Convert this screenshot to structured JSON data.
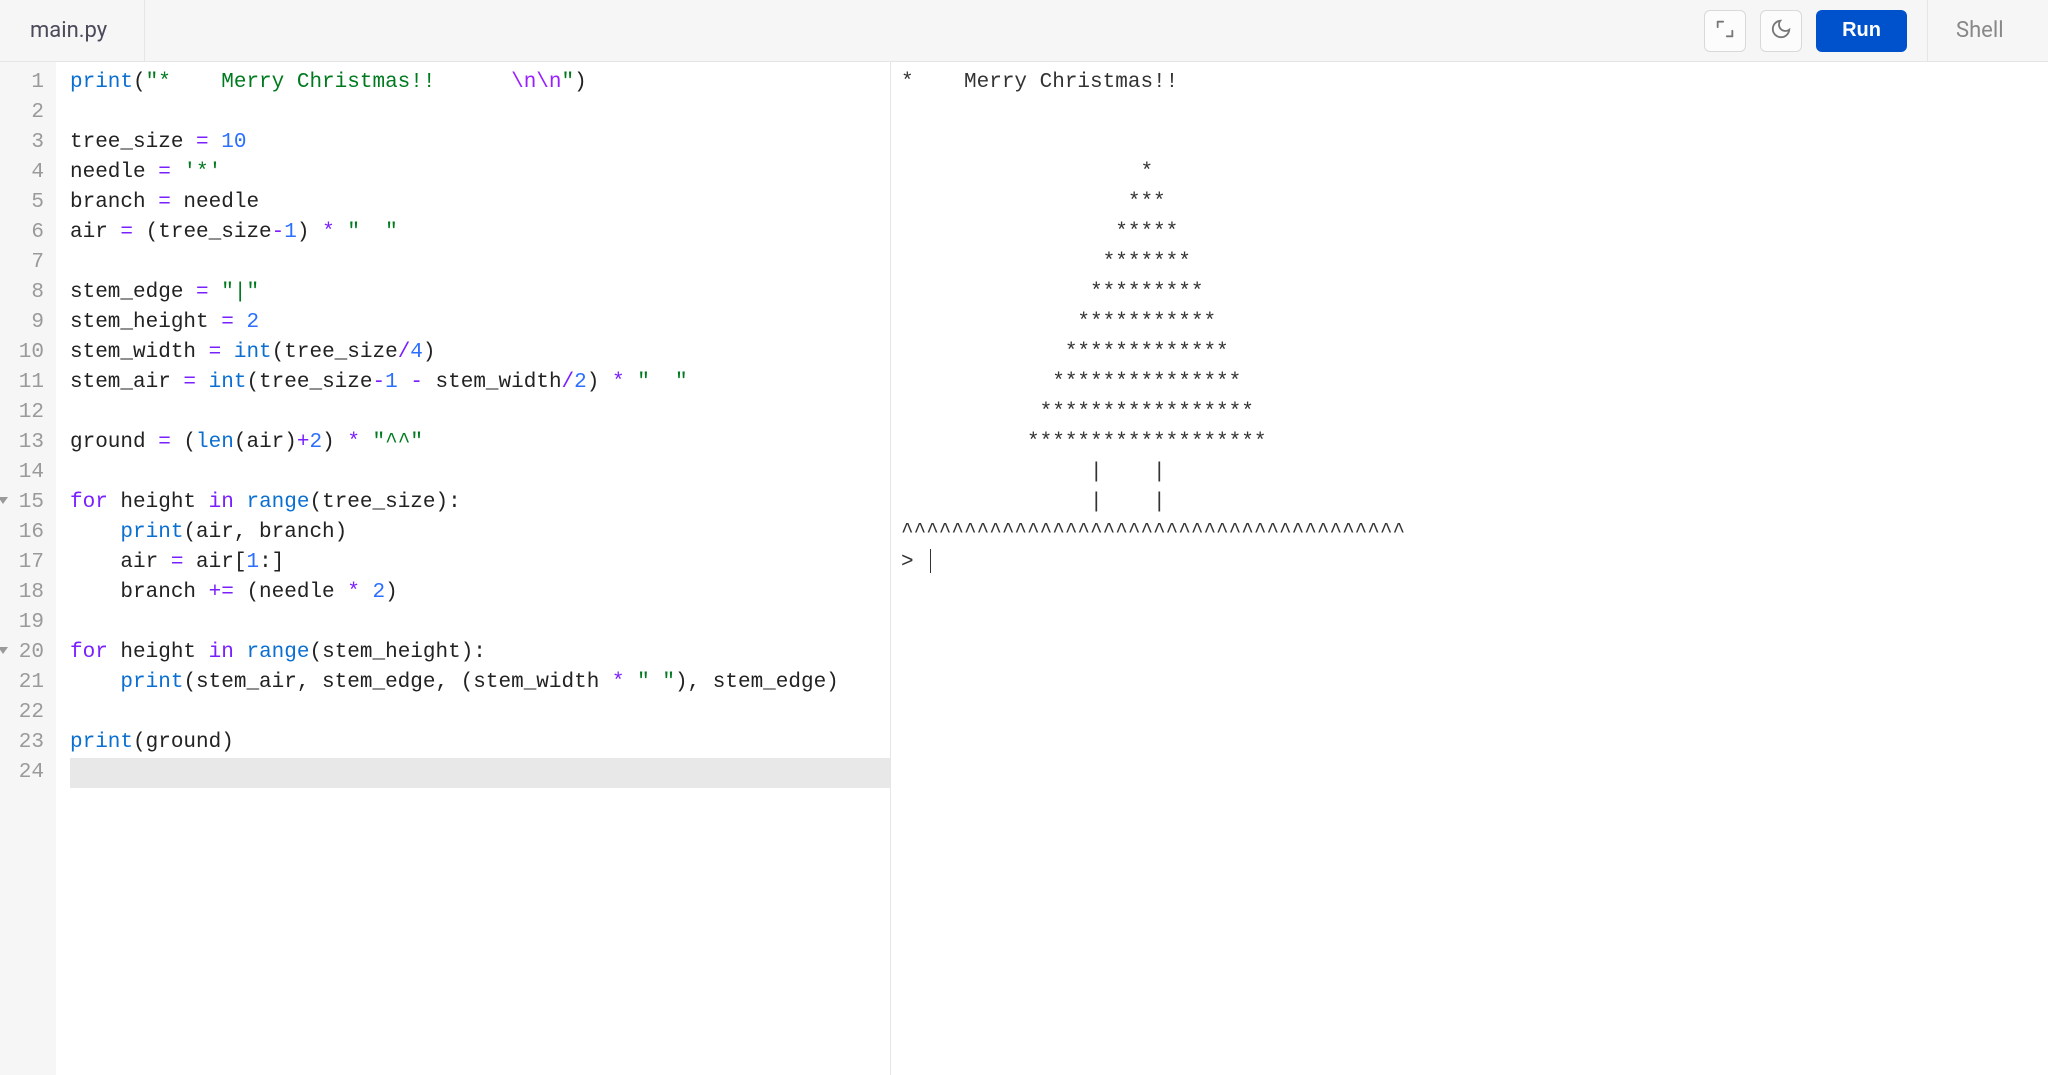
{
  "toolbar": {
    "file_tab": "main.py",
    "run_label": "Run",
    "shell_tab": "Shell"
  },
  "icons": {
    "expand": "expand-icon",
    "theme": "moon-icon"
  },
  "editor": {
    "line_numbers": [
      "1",
      "2",
      "3",
      "4",
      "5",
      "6",
      "7",
      "8",
      "9",
      "10",
      "11",
      "12",
      "13",
      "14",
      "15",
      "16",
      "17",
      "18",
      "19",
      "20",
      "21",
      "22",
      "23",
      "24"
    ],
    "fold_lines": [
      15,
      20
    ],
    "active_line": 24,
    "lines": [
      [
        {
          "t": "print",
          "c": "tok-func"
        },
        {
          "t": "(",
          "c": "tok-id"
        },
        {
          "t": "\"*    Merry Christmas!!      ",
          "c": "tok-str"
        },
        {
          "t": "\\n\\n",
          "c": "tok-esc"
        },
        {
          "t": "\"",
          "c": "tok-str"
        },
        {
          "t": ")",
          "c": "tok-id"
        }
      ],
      [],
      [
        {
          "t": "tree_size ",
          "c": "tok-id"
        },
        {
          "t": "=",
          "c": "tok-op"
        },
        {
          "t": " ",
          "c": "tok-id"
        },
        {
          "t": "10",
          "c": "tok-num"
        }
      ],
      [
        {
          "t": "needle ",
          "c": "tok-id"
        },
        {
          "t": "=",
          "c": "tok-op"
        },
        {
          "t": " ",
          "c": "tok-id"
        },
        {
          "t": "'*'",
          "c": "tok-str"
        }
      ],
      [
        {
          "t": "branch ",
          "c": "tok-id"
        },
        {
          "t": "=",
          "c": "tok-op"
        },
        {
          "t": " needle",
          "c": "tok-id"
        }
      ],
      [
        {
          "t": "air ",
          "c": "tok-id"
        },
        {
          "t": "=",
          "c": "tok-op"
        },
        {
          "t": " (tree_size",
          "c": "tok-id"
        },
        {
          "t": "-",
          "c": "tok-op"
        },
        {
          "t": "1",
          "c": "tok-num"
        },
        {
          "t": ") ",
          "c": "tok-id"
        },
        {
          "t": "*",
          "c": "tok-op"
        },
        {
          "t": " ",
          "c": "tok-id"
        },
        {
          "t": "\"  \"",
          "c": "tok-str"
        }
      ],
      [],
      [
        {
          "t": "stem_edge ",
          "c": "tok-id"
        },
        {
          "t": "=",
          "c": "tok-op"
        },
        {
          "t": " ",
          "c": "tok-id"
        },
        {
          "t": "\"|\"",
          "c": "tok-str"
        }
      ],
      [
        {
          "t": "stem_height ",
          "c": "tok-id"
        },
        {
          "t": "=",
          "c": "tok-op"
        },
        {
          "t": " ",
          "c": "tok-id"
        },
        {
          "t": "2",
          "c": "tok-num"
        }
      ],
      [
        {
          "t": "stem_width ",
          "c": "tok-id"
        },
        {
          "t": "=",
          "c": "tok-op"
        },
        {
          "t": " ",
          "c": "tok-id"
        },
        {
          "t": "int",
          "c": "tok-func"
        },
        {
          "t": "(tree_size",
          "c": "tok-id"
        },
        {
          "t": "/",
          "c": "tok-op"
        },
        {
          "t": "4",
          "c": "tok-num"
        },
        {
          "t": ")",
          "c": "tok-id"
        }
      ],
      [
        {
          "t": "stem_air ",
          "c": "tok-id"
        },
        {
          "t": "=",
          "c": "tok-op"
        },
        {
          "t": " ",
          "c": "tok-id"
        },
        {
          "t": "int",
          "c": "tok-func"
        },
        {
          "t": "(tree_size",
          "c": "tok-id"
        },
        {
          "t": "-",
          "c": "tok-op"
        },
        {
          "t": "1",
          "c": "tok-num"
        },
        {
          "t": " ",
          "c": "tok-id"
        },
        {
          "t": "-",
          "c": "tok-op"
        },
        {
          "t": " stem_width",
          "c": "tok-id"
        },
        {
          "t": "/",
          "c": "tok-op"
        },
        {
          "t": "2",
          "c": "tok-num"
        },
        {
          "t": ") ",
          "c": "tok-id"
        },
        {
          "t": "*",
          "c": "tok-op"
        },
        {
          "t": " ",
          "c": "tok-id"
        },
        {
          "t": "\"  \"",
          "c": "tok-str"
        }
      ],
      [],
      [
        {
          "t": "ground ",
          "c": "tok-id"
        },
        {
          "t": "=",
          "c": "tok-op"
        },
        {
          "t": " (",
          "c": "tok-id"
        },
        {
          "t": "len",
          "c": "tok-func"
        },
        {
          "t": "(air)",
          "c": "tok-id"
        },
        {
          "t": "+",
          "c": "tok-op"
        },
        {
          "t": "2",
          "c": "tok-num"
        },
        {
          "t": ") ",
          "c": "tok-id"
        },
        {
          "t": "*",
          "c": "tok-op"
        },
        {
          "t": " ",
          "c": "tok-id"
        },
        {
          "t": "\"^^\"",
          "c": "tok-str"
        }
      ],
      [],
      [
        {
          "t": "for",
          "c": "tok-kw"
        },
        {
          "t": " height ",
          "c": "tok-id"
        },
        {
          "t": "in",
          "c": "tok-kw"
        },
        {
          "t": " ",
          "c": "tok-id"
        },
        {
          "t": "range",
          "c": "tok-func"
        },
        {
          "t": "(tree_size):",
          "c": "tok-id"
        }
      ],
      [
        {
          "t": "    ",
          "c": "tok-id"
        },
        {
          "t": "print",
          "c": "tok-func"
        },
        {
          "t": "(air, branch)",
          "c": "tok-id"
        }
      ],
      [
        {
          "t": "    air ",
          "c": "tok-id"
        },
        {
          "t": "=",
          "c": "tok-op"
        },
        {
          "t": " air[",
          "c": "tok-id"
        },
        {
          "t": "1",
          "c": "tok-num"
        },
        {
          "t": ":]",
          "c": "tok-id"
        }
      ],
      [
        {
          "t": "    branch ",
          "c": "tok-id"
        },
        {
          "t": "+=",
          "c": "tok-op"
        },
        {
          "t": " (needle ",
          "c": "tok-id"
        },
        {
          "t": "*",
          "c": "tok-op"
        },
        {
          "t": " ",
          "c": "tok-id"
        },
        {
          "t": "2",
          "c": "tok-num"
        },
        {
          "t": ")",
          "c": "tok-id"
        }
      ],
      [],
      [
        {
          "t": "for",
          "c": "tok-kw"
        },
        {
          "t": " height ",
          "c": "tok-id"
        },
        {
          "t": "in",
          "c": "tok-kw"
        },
        {
          "t": " ",
          "c": "tok-id"
        },
        {
          "t": "range",
          "c": "tok-func"
        },
        {
          "t": "(stem_height):",
          "c": "tok-id"
        }
      ],
      [
        {
          "t": "    ",
          "c": "tok-id"
        },
        {
          "t": "print",
          "c": "tok-func"
        },
        {
          "t": "(stem_air, stem_edge, (stem_width ",
          "c": "tok-id"
        },
        {
          "t": "*",
          "c": "tok-op"
        },
        {
          "t": " ",
          "c": "tok-id"
        },
        {
          "t": "\" \"",
          "c": "tok-str"
        },
        {
          "t": "), stem_edge)",
          "c": "tok-id"
        }
      ],
      [],
      [
        {
          "t": "print",
          "c": "tok-func"
        },
        {
          "t": "(ground)",
          "c": "tok-id"
        }
      ],
      []
    ]
  },
  "shell": {
    "output_lines": [
      "*    Merry Christmas!!      ",
      "",
      "",
      "                   *",
      "                  ***",
      "                 *****",
      "                *******",
      "               *********",
      "              ***********",
      "             *************",
      "            ***************",
      "           *****************",
      "          *******************",
      "               |    |",
      "               |    |",
      "^^^^^^^^^^^^^^^^^^^^^^^^^^^^^^^^^^^^^^^^"
    ],
    "prompt": "> "
  }
}
